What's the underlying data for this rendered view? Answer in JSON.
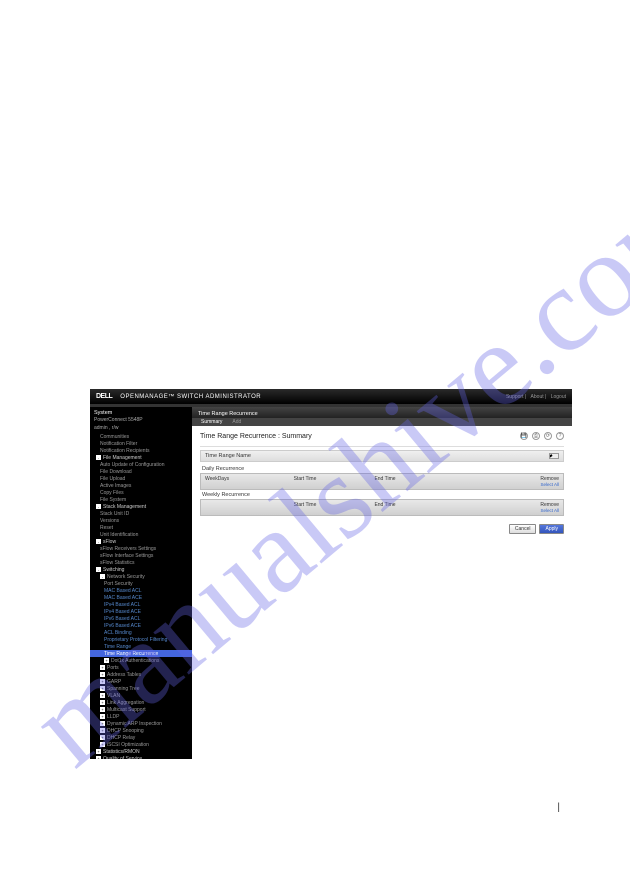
{
  "watermark": "manualshive.com",
  "header": {
    "logo": "DELL",
    "title": "OPENMANAGE™ SWITCH ADMINISTRATOR",
    "links": [
      "Support",
      "About",
      "Logout"
    ]
  },
  "sidebar": {
    "system_label": "System",
    "device": "PowerConnect 5548P",
    "user": "admin , r/w",
    "items": [
      {
        "label": "Communities",
        "lvl": 2
      },
      {
        "label": "Notification Filter",
        "lvl": 2
      },
      {
        "label": "Notification Recipients",
        "lvl": 2
      },
      {
        "label": "File Management",
        "lvl": 1,
        "box": "-"
      },
      {
        "label": "Auto Update of Configuration",
        "lvl": 2
      },
      {
        "label": "File Download",
        "lvl": 2
      },
      {
        "label": "File Upload",
        "lvl": 2
      },
      {
        "label": "Active Images",
        "lvl": 2
      },
      {
        "label": "Copy Files",
        "lvl": 2
      },
      {
        "label": "File System",
        "lvl": 2
      },
      {
        "label": "Stack Management",
        "lvl": 1,
        "box": "-"
      },
      {
        "label": "Stack Unit ID",
        "lvl": 2
      },
      {
        "label": "Versions",
        "lvl": 2
      },
      {
        "label": "Reset",
        "lvl": 2
      },
      {
        "label": "Unit Identification",
        "lvl": 2
      },
      {
        "label": "sFlow",
        "lvl": 1,
        "box": "-"
      },
      {
        "label": "sFlow Receivers Settings",
        "lvl": 2
      },
      {
        "label": "sFlow Interface Settings",
        "lvl": 2
      },
      {
        "label": "sFlow Statistics",
        "lvl": 2
      },
      {
        "label": "Switching",
        "lvl": 1,
        "box": "-"
      },
      {
        "label": "Network Security",
        "lvl": 2,
        "box": "-"
      },
      {
        "label": "Port Security",
        "lvl": 3
      },
      {
        "label": "MAC Based ACL",
        "lvl": 3,
        "link": true
      },
      {
        "label": "MAC Based ACE",
        "lvl": 3,
        "link": true
      },
      {
        "label": "IPv4 Based ACL",
        "lvl": 3,
        "link": true
      },
      {
        "label": "IPv4 Based ACE",
        "lvl": 3,
        "link": true
      },
      {
        "label": "IPv6 Based ACL",
        "lvl": 3,
        "link": true
      },
      {
        "label": "IPv6 Based ACE",
        "lvl": 3,
        "link": true
      },
      {
        "label": "ACL Binding",
        "lvl": 3,
        "link": true
      },
      {
        "label": "Proprietary Protocol Filtering",
        "lvl": 3,
        "link": true
      },
      {
        "label": "Time Range",
        "lvl": 3,
        "link": true
      },
      {
        "label": "Time Range Recurrence",
        "lvl": 3,
        "active": true
      },
      {
        "label": "Dot1x Authentications",
        "lvl": 3,
        "box": "+"
      },
      {
        "label": "Ports",
        "lvl": 2,
        "box": "+"
      },
      {
        "label": "Address Tables",
        "lvl": 2,
        "box": "+"
      },
      {
        "label": "GARP",
        "lvl": 2,
        "box": "+"
      },
      {
        "label": "Spanning Tree",
        "lvl": 2,
        "box": "+"
      },
      {
        "label": "VLAN",
        "lvl": 2,
        "box": "+"
      },
      {
        "label": "Link Aggregation",
        "lvl": 2,
        "box": "+"
      },
      {
        "label": "Multicast Support",
        "lvl": 2,
        "box": "+"
      },
      {
        "label": "LLDP",
        "lvl": 2,
        "box": "+"
      },
      {
        "label": "Dynamic ARP Inspection",
        "lvl": 2,
        "box": "+"
      },
      {
        "label": "DHCP Snooping",
        "lvl": 2,
        "box": "+"
      },
      {
        "label": "DHCP Relay",
        "lvl": 2,
        "box": "+"
      },
      {
        "label": "iSCSI Optimization",
        "lvl": 2,
        "box": "+"
      },
      {
        "label": "Statistics/RMON",
        "lvl": 1,
        "box": "+"
      },
      {
        "label": "Quality of Service",
        "lvl": 1,
        "box": "+"
      }
    ]
  },
  "content": {
    "page_title": "Time Range Recurrence",
    "tabs": [
      {
        "label": "Summary",
        "active": true
      },
      {
        "label": "Add",
        "active": false
      }
    ],
    "heading": "Time Range Recurrence : Summary",
    "toolbar_icons": [
      "save",
      "print",
      "refresh",
      "help"
    ],
    "field_label": "Time Range Name",
    "section_daily": "Daily Recurrence",
    "daily_cols": {
      "weekdays": "WeekDays",
      "start": "Start Time",
      "end": "End Time",
      "remove": "Remove",
      "select_all": "Select All"
    },
    "section_weekly": "Weekly Recurrence",
    "weekly_cols": {
      "start": "Start Time",
      "end": "End Time",
      "remove": "Remove",
      "select_all": "Select All"
    },
    "buttons": {
      "cancel": "Cancel",
      "apply": "Apply"
    }
  },
  "footer": "|"
}
